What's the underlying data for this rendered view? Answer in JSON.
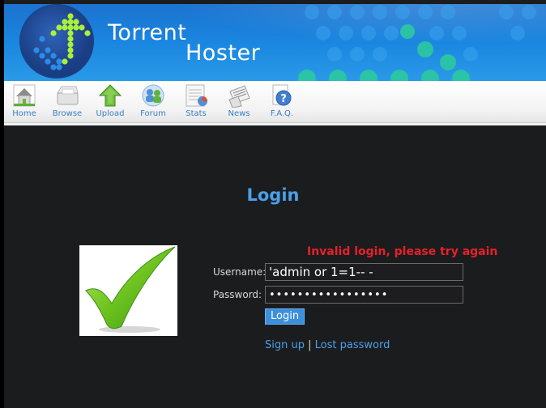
{
  "banner": {
    "title_line1": "Torrent",
    "title_line2": "Hoster"
  },
  "nav": {
    "items": [
      {
        "label": "Home",
        "icon": "home-icon"
      },
      {
        "label": "Browse",
        "icon": "browse-icon"
      },
      {
        "label": "Upload",
        "icon": "upload-icon"
      },
      {
        "label": "Forum",
        "icon": "forum-icon"
      },
      {
        "label": "Stats",
        "icon": "stats-icon"
      },
      {
        "label": "News",
        "icon": "news-icon"
      },
      {
        "label": "F.A.Q.",
        "icon": "faq-icon"
      }
    ]
  },
  "main": {
    "title": "Login",
    "error": "Invalid login, please try again",
    "username_label": "Username:",
    "username_value": "'admin or 1=1-- -",
    "password_label": "Password:",
    "password_value": "•••••••••••••••••",
    "login_button": "Login",
    "signup_link": "Sign up",
    "separator": "|",
    "lost_password_link": "Lost password"
  },
  "colors": {
    "accent": "#4aa0e8",
    "error": "#e8202a",
    "banner_blue": "#1a86e0",
    "checkmark_green": "#6cc21f"
  }
}
